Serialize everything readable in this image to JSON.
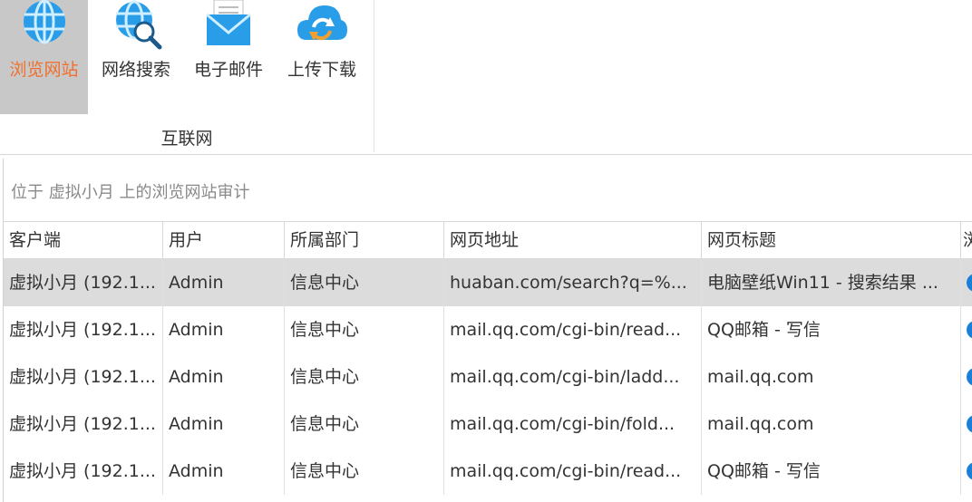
{
  "ribbon": {
    "buttons": [
      {
        "label": "浏览网站",
        "icon": "globe-icon",
        "active": true
      },
      {
        "label": "网络搜索",
        "icon": "globe-search-icon",
        "active": false
      },
      {
        "label": "电子邮件",
        "icon": "mail-icon",
        "active": false
      },
      {
        "label": "上传下载",
        "icon": "cloud-sync-icon",
        "active": false
      }
    ],
    "group_label": "互联网"
  },
  "panel": {
    "caption": "位于 虚拟小月 上的浏览网站审计"
  },
  "colors": {
    "accent": "#f07030",
    "selected_bg": "#dcdcdc",
    "status_dot": "#1a7fd6"
  },
  "table": {
    "columns": [
      "客户端",
      "用户",
      "所属部门",
      "网页地址",
      "网页标题",
      "浏"
    ],
    "rows": [
      {
        "client": "虚拟小月 (192.1...",
        "user": "Admin",
        "dept": "信息中心",
        "url": "huaban.com/search?q=%...",
        "title": "电脑壁纸Win11 - 搜索结果 ..."
      },
      {
        "client": "虚拟小月 (192.1...",
        "user": "Admin",
        "dept": "信息中心",
        "url": "mail.qq.com/cgi-bin/read...",
        "title": "QQ邮箱 - 写信"
      },
      {
        "client": "虚拟小月 (192.1...",
        "user": "Admin",
        "dept": "信息中心",
        "url": "mail.qq.com/cgi-bin/ladd...",
        "title": "mail.qq.com"
      },
      {
        "client": "虚拟小月 (192.1...",
        "user": "Admin",
        "dept": "信息中心",
        "url": "mail.qq.com/cgi-bin/fold...",
        "title": "mail.qq.com"
      },
      {
        "client": "虚拟小月 (192.1...",
        "user": "Admin",
        "dept": "信息中心",
        "url": "mail.qq.com/cgi-bin/read...",
        "title": "QQ邮箱 - 写信"
      }
    ]
  }
}
